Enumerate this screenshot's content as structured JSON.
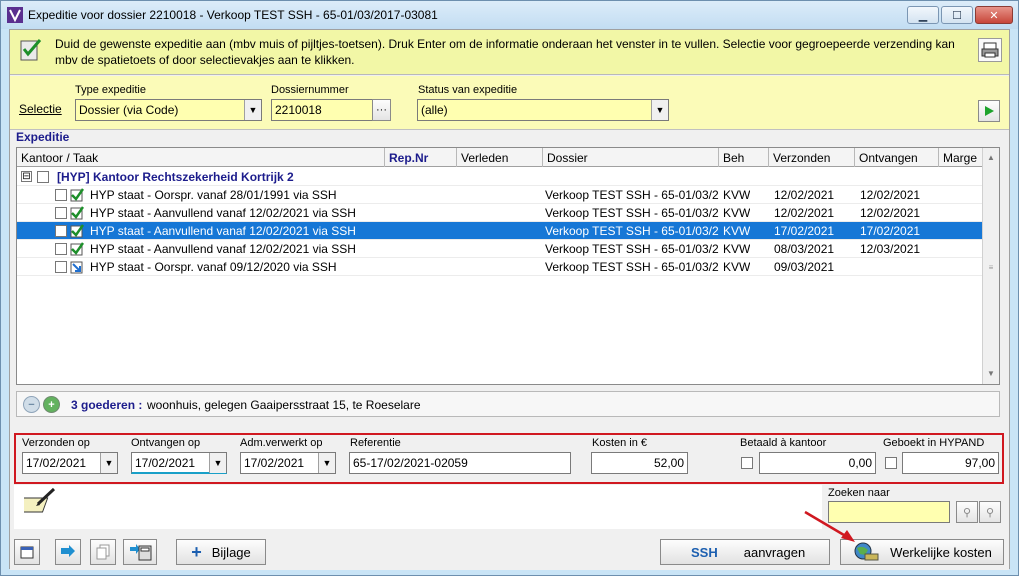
{
  "window": {
    "title": "Expeditie voor dossier 2210018 - Verkoop TEST SSH - 65-01/03/2017-03081",
    "minimize_label": "▁",
    "maximize_label": "☐",
    "close_label": "✕"
  },
  "info": {
    "text": "Duid de gewenste expeditie aan (mbv muis of pijltjes-toetsen). Druk Enter om de informatie onderaan het venster in te vullen. Selectie voor gegroepeerde verzending kan mbv de spatietoets of door selectievakjes aan te klikken."
  },
  "selection": {
    "label": "Selectie",
    "type_label": "Type expeditie",
    "type_value": "Dossier (via Code)",
    "dossier_label": "Dossiernummer",
    "dossier_value": "2210018",
    "dossier_browse": "···",
    "status_label": "Status van expeditie",
    "status_value": "(alle)"
  },
  "expeditie": {
    "group_label": "Expeditie",
    "columns": [
      "Kantoor / Taak",
      "Rep.Nr",
      "Verleden",
      "Dossier",
      "Beh",
      "Verzonden",
      "Ontvangen",
      "Marge"
    ],
    "group_row": {
      "toggle": "⊟",
      "label": "[HYP] Kantoor Rechtszekerheid Kortrijk 2"
    },
    "rows": [
      {
        "taak": "HYP staat - Oorspr. vanaf 28/01/1991 via SSH",
        "dossier": "Verkoop TEST SSH - 65-01/03/2",
        "beh": "KVW",
        "verzonden": "12/02/2021",
        "ontvangen": "12/02/2021",
        "status": "done"
      },
      {
        "taak": "HYP staat - Aanvullend vanaf 12/02/2021 via SSH",
        "dossier": "Verkoop TEST SSH - 65-01/03/2",
        "beh": "KVW",
        "verzonden": "12/02/2021",
        "ontvangen": "12/02/2021",
        "status": "done"
      },
      {
        "taak": "HYP staat - Aanvullend vanaf 12/02/2021 via SSH",
        "dossier": "Verkoop TEST SSH - 65-01/03/2",
        "beh": "KVW",
        "verzonden": "17/02/2021",
        "ontvangen": "17/02/2021",
        "status": "done",
        "selected": true
      },
      {
        "taak": "HYP staat - Aanvullend vanaf 12/02/2021 via SSH",
        "dossier": "Verkoop TEST SSH - 65-01/03/2",
        "beh": "KVW",
        "verzonden": "08/03/2021",
        "ontvangen": "12/03/2021",
        "status": "done"
      },
      {
        "taak": "HYP staat - Oorspr. vanaf 09/12/2020 via SSH",
        "dossier": "Verkoop TEST SSH - 65-01/03/2",
        "beh": "KVW",
        "verzonden": "09/03/2021",
        "ontvangen": "",
        "status": "sent"
      }
    ]
  },
  "goods": {
    "count_label": "3 goederen :",
    "description": "woonhuis, gelegen Gaaipersstraat 15, te Roeselare"
  },
  "detail": {
    "verzonden_label": "Verzonden op",
    "verzonden_value": "17/02/2021",
    "ontvangen_label": "Ontvangen op",
    "ontvangen_value": "17/02/2021",
    "adm_label": "Adm.verwerkt op",
    "adm_value": "17/02/2021",
    "referentie_label": "Referentie",
    "referentie_value": "65-17/02/2021-02059",
    "kosten_label": "Kosten in €",
    "kosten_value": "52,00",
    "betaald_label": "Betaald à kantoor",
    "betaald_value": "0,00",
    "geboekt_label": "Geboekt in HYPAND",
    "geboekt_value": "97,00"
  },
  "search": {
    "label": "Zoeken naar",
    "value": ""
  },
  "toolbar": {
    "bijlage_label": "Bijlage",
    "ssh_label": "SSH",
    "aanvragen_label": "aanvragen",
    "kosten_label": "Werkelijke kosten"
  },
  "colors": {
    "selection_blue": "#1677d6",
    "highlight_red": "#d01820",
    "info_yellow": "#f2f7a6",
    "field_yellow": "#ffffb0"
  }
}
